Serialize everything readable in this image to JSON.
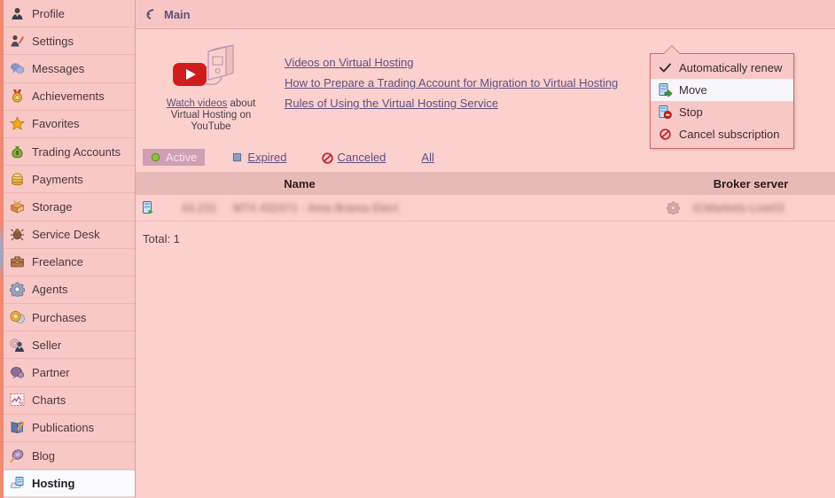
{
  "sidebar": {
    "items": [
      {
        "label": "Profile",
        "icon": "user-icon",
        "active": false
      },
      {
        "label": "Settings",
        "icon": "pencil-icon",
        "active": false
      },
      {
        "label": "Messages",
        "icon": "chat-bubble-icon",
        "active": false
      },
      {
        "label": "Achievements",
        "icon": "medal-icon",
        "active": false
      },
      {
        "label": "Favorites",
        "icon": "star-icon",
        "active": false
      },
      {
        "label": "Trading Accounts",
        "icon": "money-bag-icon",
        "active": false
      },
      {
        "label": "Payments",
        "icon": "coins-icon",
        "active": false
      },
      {
        "label": "Storage",
        "icon": "open-box-icon",
        "active": false
      },
      {
        "label": "Service Desk",
        "icon": "bug-icon",
        "active": false
      },
      {
        "label": "Freelance",
        "icon": "briefcase-icon",
        "active": false
      },
      {
        "label": "Agents",
        "icon": "gear-icon",
        "active": false
      },
      {
        "label": "Purchases",
        "icon": "coin-disc-icon",
        "active": false
      },
      {
        "label": "Seller",
        "icon": "seller-icon",
        "active": false
      },
      {
        "label": "Partner",
        "icon": "handshake-icon",
        "active": false
      },
      {
        "label": "Charts",
        "icon": "chart-icon",
        "active": false
      },
      {
        "label": "Publications",
        "icon": "book-pencil-icon",
        "active": false
      },
      {
        "label": "Blog",
        "icon": "quill-icon",
        "active": false
      },
      {
        "label": "Hosting",
        "icon": "server-cloud-icon",
        "active": true
      }
    ]
  },
  "header": {
    "title": "Main",
    "back_icon": "back-arrow-icon"
  },
  "promo": {
    "icon": "youtube-server-cloud-icon",
    "caption_link": "Watch videos",
    "caption_rest": " about Virtual Hosting on YouTube",
    "links": [
      "Videos on Virtual Hosting",
      "How to Prepare a Trading Account for Migration to Virtual Hosting",
      "Rules of Using the Virtual Hosting Service"
    ]
  },
  "filters": [
    {
      "label": "Active",
      "icon": "green-dot-icon",
      "selected": true
    },
    {
      "label": "Expired",
      "icon": "blue-square-icon",
      "selected": false
    },
    {
      "label": "Canceled",
      "icon": "no-entry-icon",
      "selected": false
    },
    {
      "label": "All",
      "icon": "none",
      "selected": false
    }
  ],
  "table": {
    "columns": {
      "name": "Name",
      "broker": "Broker server"
    },
    "rows": [
      {
        "status_icon": "server-running-icon",
        "id_redacted": "43.231",
        "name_redacted": "MT4 432471 - Ama Brama Elect",
        "gear_icon": "gear-icon",
        "broker_redacted": "ICMarkets-Live03"
      }
    ],
    "total_label": "Total: 1"
  },
  "context_menu": {
    "items": [
      {
        "label": "Automatically renew",
        "icon": "check-icon",
        "highlighted": false
      },
      {
        "label": "Move",
        "icon": "server-move-icon",
        "highlighted": true
      },
      {
        "label": "Stop",
        "icon": "server-stop-icon",
        "highlighted": false
      },
      {
        "label": "Cancel subscription",
        "icon": "no-entry-icon",
        "highlighted": false
      }
    ]
  },
  "colors": {
    "page_bg": "#fbd0cd",
    "sidebar_bg": "#f8c8c6",
    "header_bg": "#f7c6c4",
    "table_head_bg": "#e8bab7",
    "selected_tab_bg": "#cf9fb3",
    "link": "#5f5080",
    "accent_red": "#c8202a",
    "menu_border": "#c96b64"
  }
}
